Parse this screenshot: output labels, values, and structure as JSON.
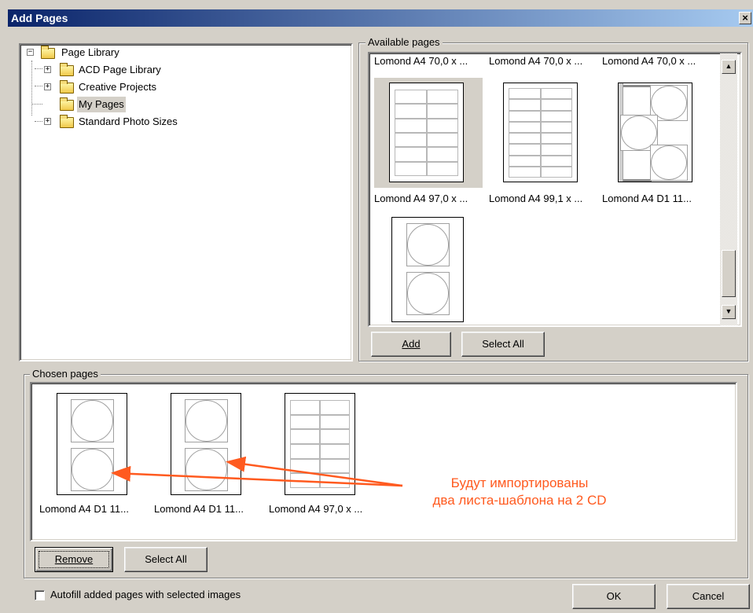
{
  "window": {
    "title": "Add Pages",
    "close_glyph": "×"
  },
  "tree": {
    "items": [
      {
        "label": "Page Library",
        "expander": "−"
      },
      {
        "label": "ACD Page Library",
        "expander": "+"
      },
      {
        "label": "Creative Projects",
        "expander": "+"
      },
      {
        "label": "My Pages",
        "expander": ""
      },
      {
        "label": "Standard Photo Sizes",
        "expander": "+"
      }
    ]
  },
  "available": {
    "group_label": "Available pages",
    "top_captions": [
      "Lomond A4 70,0 x ...",
      "Lomond A4 70,0 x ...",
      "Lomond A4 70,0 x ..."
    ],
    "captions": [
      "Lomond A4 97,0 x ...",
      "Lomond A4 99,1 x ...",
      "Lomond A4 D1 11..."
    ],
    "add_label": "Add",
    "select_all_label": "Select All"
  },
  "chosen": {
    "group_label": "Chosen pages",
    "captions": [
      "Lomond A4 D1 11...",
      "Lomond A4 D1 11...",
      "Lomond A4 97,0 x ..."
    ],
    "remove_label": "Remove",
    "select_all_label": "Select All"
  },
  "annotation": {
    "line1": "Будут импортированы",
    "line2": "два листа-шаблона на 2 CD",
    "color": "#ff5a1f"
  },
  "footer": {
    "autofill_label": "Autofill added pages with selected images",
    "autofill_checked": false,
    "ok_label": "OK",
    "cancel_label": "Cancel"
  }
}
